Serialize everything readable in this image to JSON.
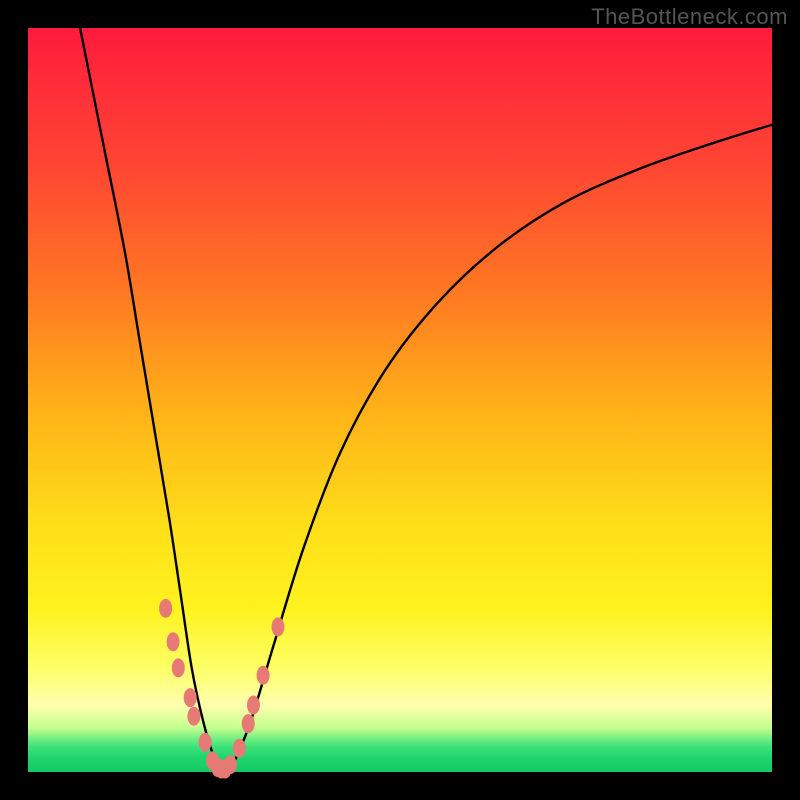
{
  "watermark": "TheBottleneck.com",
  "chart_data": {
    "type": "line",
    "title": "",
    "xlabel": "",
    "ylabel": "",
    "xlim": [
      0,
      100
    ],
    "ylim": [
      0,
      100
    ],
    "series": [
      {
        "name": "bottleneck-curve",
        "x": [
          7,
          10,
          13,
          15,
          17,
          19,
          20.5,
          22,
          23.5,
          25,
          26,
          27,
          28,
          30,
          33,
          37,
          42,
          48,
          55,
          63,
          72,
          82,
          92,
          100
        ],
        "values": [
          100,
          85,
          70,
          58,
          46,
          34,
          24,
          14,
          7,
          2,
          0.4,
          0.4,
          2,
          7,
          17,
          30,
          43,
          54,
          63,
          70.5,
          76.5,
          81,
          84.5,
          87
        ]
      }
    ],
    "markers": {
      "name": "highlight-beads",
      "color": "#e77a74",
      "points_xy": [
        [
          18.5,
          22
        ],
        [
          19.5,
          17.5
        ],
        [
          20.2,
          14
        ],
        [
          21.8,
          10
        ],
        [
          22.3,
          7.5
        ],
        [
          23.8,
          4
        ],
        [
          24.8,
          1.5
        ],
        [
          25.5,
          0.6
        ],
        [
          26.0,
          0.4
        ],
        [
          26.5,
          0.4
        ],
        [
          27.2,
          1.0
        ],
        [
          28.4,
          3.2
        ],
        [
          29.6,
          6.5
        ],
        [
          30.3,
          9
        ],
        [
          31.6,
          13
        ],
        [
          33.6,
          19.5
        ]
      ]
    },
    "gradient_stops": [
      {
        "pos": 0.0,
        "color": "#ff1a3c"
      },
      {
        "pos": 0.36,
        "color": "#ff7a22"
      },
      {
        "pos": 0.68,
        "color": "#ffe11a"
      },
      {
        "pos": 0.91,
        "color": "#feffae"
      },
      {
        "pos": 0.97,
        "color": "#2bdb72"
      },
      {
        "pos": 1.0,
        "color": "#15c962"
      }
    ]
  }
}
